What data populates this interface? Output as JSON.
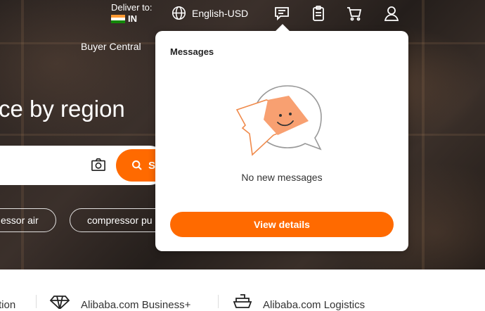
{
  "header": {
    "deliver_label": "Deliver to:",
    "country_code": "IN",
    "language_currency": "English-USD",
    "buyer_central": "Buyer Central"
  },
  "hero": {
    "headline": "ce by region",
    "search_button_label": "S",
    "chips": [
      "essor air",
      "compressor pu"
    ]
  },
  "bottom_bar": {
    "items": [
      "tion",
      "Alibaba.com Business+",
      "Alibaba.com Logistics"
    ]
  },
  "messages_popup": {
    "title": "Messages",
    "empty_text": "No new messages",
    "view_details_label": "View details"
  },
  "colors": {
    "accent": "#ff6a00"
  },
  "icons": [
    "globe-icon",
    "messages-icon",
    "orders-icon",
    "cart-icon",
    "account-icon",
    "camera-icon",
    "search-icon",
    "diamond-icon",
    "ship-icon"
  ]
}
